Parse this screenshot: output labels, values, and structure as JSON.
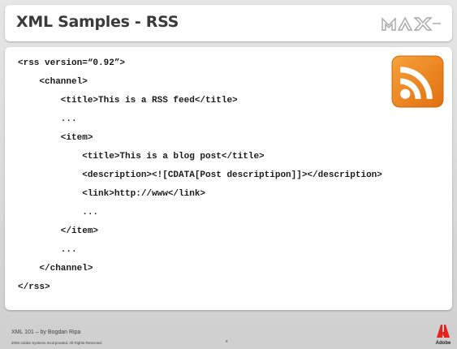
{
  "slide": {
    "title": "XML Samples - RSS",
    "header_logo_icon": "max-logo",
    "code_lines": [
      "<rss version=“0.92”>",
      "    <channel>",
      "        <title>This is a RSS feed</title>",
      "        ...",
      "        <item>",
      "            <title>This is a blog post</title>",
      "            <description><![CDATA[Post descriptipon]]></description>",
      "            <link>http://www</link>",
      "            ...",
      "        </item>",
      "        ...",
      "    </channel>",
      "</rss>"
    ],
    "feed_icon": "rss-feed-icon"
  },
  "footer": {
    "presentation": "XML 101 – by Bogdan Ripa",
    "copyright": "2006 Adobe Systems Incorporated.  All Rights Reserved.",
    "page_number": "9",
    "brand": "Adobe"
  },
  "colors": {
    "rss_orange": "#f28a1a",
    "adobe_red": "#e8221c",
    "max_logo_gray": "#a8a8a8"
  }
}
